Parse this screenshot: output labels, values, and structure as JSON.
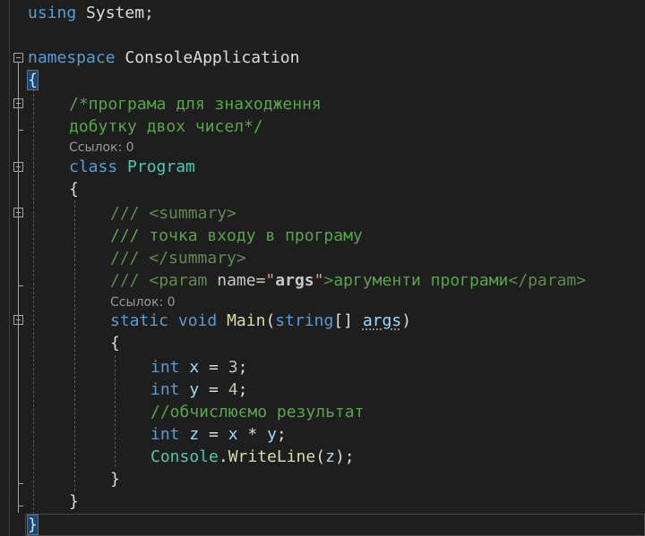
{
  "editor": {
    "language": "C#",
    "lines": {
      "using_kw": "using",
      "using_rest": " System;",
      "ns_kw": "namespace",
      "ns_name": " ConsoleApplication",
      "brace_open_ns": "{",
      "comment1": "/*програма для знаходження",
      "comment2": "добутку двох чисел*/",
      "class_kw": "class",
      "class_name": "Program",
      "brace_open_class": "{",
      "doc1_prefix": "/// ",
      "doc1_tag": "<summary>",
      "doc2": "/// точка входу в програму",
      "doc3_prefix": "/// ",
      "doc3_tag": "</summary>",
      "doc4_prefix": "/// ",
      "doc4_tag_open": "<param",
      "doc4_attr": " name",
      "doc4_eq": "=",
      "doc4_quote1": "\"",
      "doc4_value": "args",
      "doc4_quote2": "\"",
      "doc4_tag_close": ">",
      "doc4_text": "аргументи програми",
      "doc4_end_tag": "</param>",
      "main_static": "static",
      "main_void": "void",
      "main_name": "Main",
      "main_lparen": "(",
      "main_string": "string",
      "main_brackets": "[] ",
      "main_args": "args",
      "main_rparen": ")",
      "brace_open_main": "{",
      "x_int": "int",
      "x_name": "x",
      "x_assign": " = ",
      "x_value": "3",
      "x_semi": ";",
      "y_int": "int",
      "y_name": "y",
      "y_assign": " = ",
      "y_value": "4",
      "y_semi": ";",
      "comment3": "//обчислюємо результат",
      "z_int": "int",
      "z_name": "z",
      "z_assign": " = ",
      "z_x": "x",
      "z_mul": " * ",
      "z_y": "y",
      "z_semi": ";",
      "cw_console": "Console",
      "cw_dot": ".",
      "cw_method": "WriteLine",
      "cw_lparen": "(",
      "cw_arg": "z",
      "cw_rest": ");",
      "brace_close_main": "}",
      "brace_close_class": "}",
      "brace_close_ns": "}"
    },
    "codelens": {
      "class_refs": "Ссылок: 0",
      "main_refs": "Ссылок: 0"
    }
  },
  "colors": {
    "background": "#1e1e1e",
    "keyword": "#569cd6",
    "type": "#4ec9b0",
    "comment": "#57a64a",
    "method": "#dcdcaa",
    "number": "#b5cea8",
    "variable": "#9cdcfe"
  }
}
